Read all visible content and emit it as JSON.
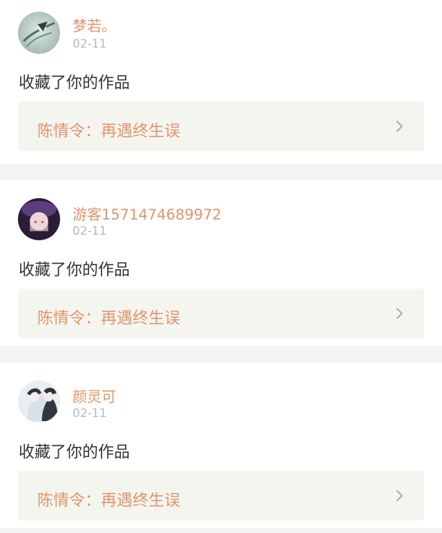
{
  "notifications": [
    {
      "username": "梦若。",
      "date": "02-11",
      "action": "收藏了你的作品",
      "work_title": "陈情令：再遇终生误",
      "avatar_icon": "avatar-illustration-icon",
      "avatar_colors": [
        "#b9c9c4",
        "#6f8d86"
      ]
    },
    {
      "username": "游客1571474689972",
      "date": "02-11",
      "action": "收藏了你的作品",
      "work_title": "陈情令：再遇终生误",
      "avatar_icon": "avatar-illustration-icon",
      "avatar_colors": [
        "#3d2a55",
        "#f1d9d7"
      ]
    },
    {
      "username": "颜灵可",
      "date": "02-11",
      "action": "收藏了你的作品",
      "work_title": "陈情令：再遇终生误",
      "avatar_icon": "avatar-illustration-icon",
      "avatar_colors": [
        "#dfe3e7",
        "#2f3238"
      ]
    }
  ],
  "colors": {
    "accent": "#e0956a",
    "date": "#b8b8b8",
    "text": "#333333",
    "link_bg": "#f5f5f0",
    "separator": "#f3f3f1"
  }
}
